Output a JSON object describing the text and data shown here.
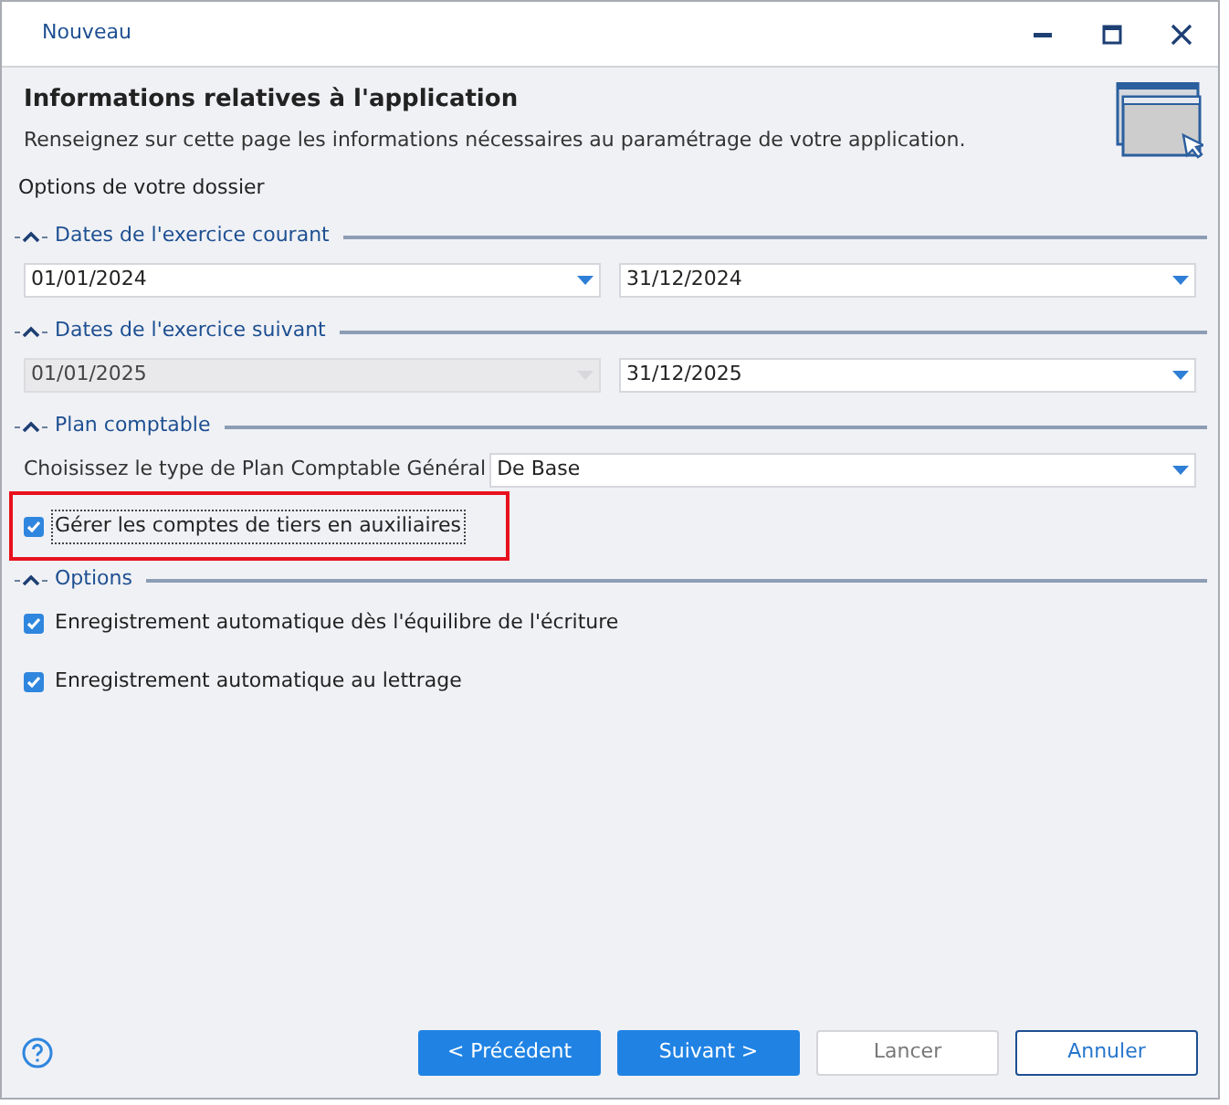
{
  "window": {
    "title": "Nouveau"
  },
  "header": {
    "title": "Informations relatives à l'application",
    "description": "Renseignez sur cette page les informations nécessaires au paramétrage de votre application."
  },
  "section_label": "Options de votre dossier",
  "groups": [
    {
      "title": "Dates de l'exercice courant",
      "expanded": true,
      "rows": [
        {
          "kind": "dates",
          "fields": [
            {
              "value": "01/01/2024",
              "disabled": false
            },
            {
              "value": "31/12/2024",
              "disabled": false
            }
          ]
        }
      ]
    },
    {
      "title": "Dates de l'exercice suivant",
      "expanded": true,
      "rows": [
        {
          "kind": "dates",
          "fields": [
            {
              "value": "01/01/2025",
              "disabled": true
            },
            {
              "value": "31/12/2025",
              "disabled": false
            }
          ]
        }
      ]
    },
    {
      "title": "Plan comptable",
      "expanded": true,
      "rows": [
        {
          "kind": "select",
          "label": "Choisissez le type de Plan Comptable Général",
          "value": "De Base"
        },
        {
          "kind": "checkbox",
          "label": "Gérer les comptes de tiers en auxiliaires",
          "checked": true,
          "highlighted": true,
          "focused": true
        }
      ]
    },
    {
      "title": "Options",
      "expanded": true,
      "rows": [
        {
          "kind": "checkbox",
          "label": "Enregistrement automatique dès l'équilibre de l'écriture",
          "checked": true,
          "highlighted": false,
          "focused": false
        },
        {
          "kind": "checkbox",
          "label": "Enregistrement automatique au lettrage",
          "checked": true,
          "highlighted": false,
          "focused": false
        }
      ]
    }
  ],
  "buttons": [
    {
      "label": "< Précédent",
      "kind": "primary"
    },
    {
      "label": "Suivant >",
      "kind": "primary"
    },
    {
      "label": "Lancer",
      "kind": "disabled"
    },
    {
      "label": "Annuler",
      "kind": "outline"
    }
  ]
}
